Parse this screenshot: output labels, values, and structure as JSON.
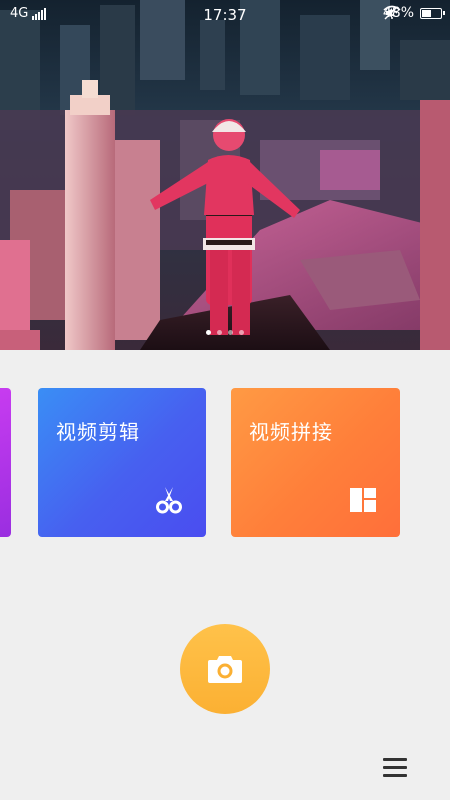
{
  "status_bar": {
    "network": "4G",
    "time": "17:37",
    "battery_percent": "48%",
    "battery_level": 0.48,
    "icons": [
      "signal-icon",
      "mute-icon",
      "wifi-icon",
      "battery-icon"
    ]
  },
  "banner": {
    "image": "santa-on-rooftop-night-city-photo",
    "dots": [
      {
        "active": true
      },
      {
        "active": false
      },
      {
        "active": false
      },
      {
        "active": false
      }
    ]
  },
  "cards": [
    {
      "label": "",
      "partial": true,
      "color": "#b435ea"
    },
    {
      "label": "视频剪辑",
      "icon": "scissors-icon",
      "color": "#4470f2"
    },
    {
      "label": "视频拼接",
      "icon": "layout-grid-icon",
      "color": "#ff7a3a"
    }
  ],
  "camera_button": {
    "icon": "camera-icon",
    "color": "#fbb033"
  },
  "menu_button": {
    "icon": "hamburger-menu-icon"
  }
}
